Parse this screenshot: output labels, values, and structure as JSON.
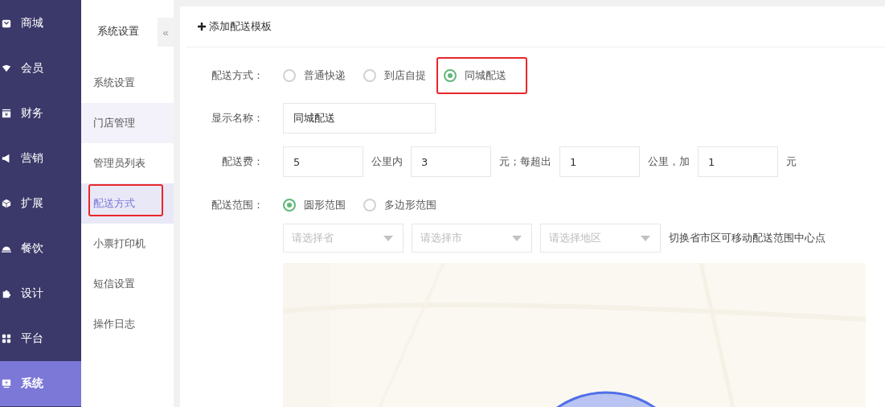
{
  "main_nav": [
    {
      "label": "商城",
      "selected": false
    },
    {
      "label": "会员",
      "selected": false
    },
    {
      "label": "财务",
      "selected": false
    },
    {
      "label": "营销",
      "selected": false
    },
    {
      "label": "扩展",
      "selected": false
    },
    {
      "label": "餐饮",
      "selected": false
    },
    {
      "label": "设计",
      "selected": false
    },
    {
      "label": "平台",
      "selected": false
    },
    {
      "label": "系统",
      "selected": true
    }
  ],
  "sub_nav": {
    "title": "系统设置",
    "collapse": "«",
    "items": [
      {
        "label": "系统设置",
        "selected": false,
        "hovered": false,
        "highlighted": false
      },
      {
        "label": "门店管理",
        "selected": false,
        "hovered": true,
        "highlighted": false
      },
      {
        "label": "管理员列表",
        "selected": false,
        "hovered": false,
        "highlighted": false
      },
      {
        "label": "配送方式",
        "selected": true,
        "hovered": false,
        "highlighted": true
      },
      {
        "label": "小票打印机",
        "selected": false,
        "hovered": false,
        "highlighted": false
      },
      {
        "label": "短信设置",
        "selected": false,
        "hovered": false,
        "highlighted": false
      },
      {
        "label": "操作日志",
        "selected": false,
        "hovered": false,
        "highlighted": false
      }
    ]
  },
  "toolbar": {
    "add_button": "添加配送模板"
  },
  "form": {
    "delivery_method": {
      "label": "配送方式：",
      "options": [
        {
          "label": "普通快递",
          "selected": false,
          "highlighted": false
        },
        {
          "label": "到店自提",
          "selected": false,
          "highlighted": false
        },
        {
          "label": "同城配送",
          "selected": true,
          "highlighted": true
        }
      ]
    },
    "display_name": {
      "label": "显示名称：",
      "value": "同城配送"
    },
    "fee": {
      "label": "配送费：",
      "parts": [
        {
          "kind": "input",
          "value": "5"
        },
        {
          "kind": "text",
          "text": "公里内"
        },
        {
          "kind": "input",
          "value": "3"
        },
        {
          "kind": "text",
          "text": "元；每超出"
        },
        {
          "kind": "input",
          "value": "1"
        },
        {
          "kind": "text",
          "text": "公里，加"
        },
        {
          "kind": "input",
          "value": "1"
        },
        {
          "kind": "text",
          "text": "元"
        }
      ]
    },
    "range": {
      "label": "配送范围：",
      "options": [
        {
          "label": "圆形范围",
          "selected": true,
          "highlighted": false
        },
        {
          "label": "多边形范围",
          "selected": false,
          "highlighted": false
        }
      ]
    },
    "region_selects": [
      {
        "placeholder": "请选择省"
      },
      {
        "placeholder": "请选择市"
      },
      {
        "placeholder": "请选择地区"
      }
    ],
    "region_hint": "切换省市区可移动配送范围中心点"
  }
}
